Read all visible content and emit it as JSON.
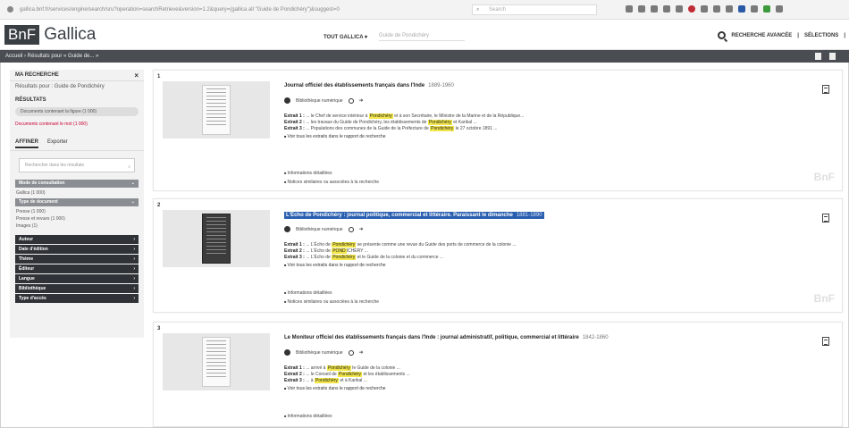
{
  "browser": {
    "url": "gallica.bnf.fr/services/engine/search/sru?operation=searchRetrieve&version=1.2&query=(gallica all \"Guide de Pondichéry\")&suggest=0",
    "search_placeholder": "Search"
  },
  "header": {
    "logo_bnf": "BnF",
    "logo_gallica": "Gallica",
    "nav_label": "TOUT GALLICA ▾",
    "search_value": "Guide de Pondichéry",
    "advanced_search": "RECHERCHE AVANCÉE",
    "selection": "SÉLECTIONS"
  },
  "breadcrumb": "Accueil › Résultats pour « Guide de... »",
  "sidebar": {
    "title": "MA RECHERCHE",
    "query": "Résultats pour : Guide de Pondichéry",
    "sort_heading": "RÉSULTATS",
    "pill": "Documents contenant la figure (1 000)",
    "link": "Documents contenant le mot (1 000)",
    "tab_refine": "AFFINER",
    "tab_other": "Exporter",
    "search_placeholder": "Rechercher dans les résultats",
    "facet_consult": "Mode de consultation",
    "consult_item": "Gallica (1 000)",
    "facet_doctype": "Type de document",
    "doctype_items": [
      "Presse (1 000)",
      "Presse et revues (1 000)",
      "Images (1)"
    ],
    "dark_facets": [
      "Auteur",
      "Date d'édition",
      "Thème",
      "Éditeur",
      "Langue",
      "Bibliothèque",
      "Type d'accès"
    ]
  },
  "results": [
    {
      "num": "1",
      "title": "Journal officiel des établissements français dans l'Inde",
      "date": "1889-1960",
      "meta": "Bibliothèque numérique",
      "extracts": [
        {
          "label": "Extrait 1 :",
          "pre": "... le Chef de service intérieur à ",
          "hl": "Pondichéry",
          "post": " et à son Secrétaire, le Ministre de la Marine et de la République..."
        },
        {
          "label": "Extrait 2 :",
          "pre": "... les travaux du Guide de Pondichéry, les établissements de ",
          "hl": "Pondichéry",
          "post": " et Karikal ..."
        },
        {
          "label": "Extrait 3 :",
          "pre": "... Populations des communes de la Guide de la Préfecture de ",
          "hl": "Pondichéry",
          "post": " le 27 octobre 1891 ..."
        }
      ],
      "more": "Voir tous les extraits dans le rapport de recherche",
      "links": [
        "Informations détaillées",
        "Notices similaires ou associées à la recherche"
      ]
    },
    {
      "num": "2",
      "title": "L'Écho de Pondichéry : journal politique, commercial et littéraire. Paraissant le dimanche",
      "date": "1881-1890",
      "meta": "Bibliothèque numérique",
      "extracts": [
        {
          "label": "Extrait 1 :",
          "pre": "... L'Écho de ",
          "hl": "Pondichéry",
          "post": " se présente comme une revue du Guide des ports de commerce de la colonie ..."
        },
        {
          "label": "Extrait 2 :",
          "pre": "... L'Écho de ",
          "hl": "POND",
          "post": "ICHÉRY ..."
        },
        {
          "label": "Extrait 3 :",
          "pre": "... L'Écho de ",
          "hl": "Pondichéry",
          "post": " et le Guide de la colonie et du commerce ..."
        }
      ],
      "more": "Voir tous les extraits dans le rapport de recherche",
      "links": [
        "Informations détaillées",
        "Notices similaires ou associées à la recherche"
      ]
    },
    {
      "num": "3",
      "title": "Le Moniteur officiel des établissements français dans l'Inde : journal administratif, politique, commercial et littéraire",
      "date": "1842-1860",
      "meta": "Bibliothèque numérique",
      "extracts": [
        {
          "label": "Extrait 1 :",
          "pre": "... arrivé à ",
          "hl": "Pondichéry",
          "post": " le Guide de la colonie ..."
        },
        {
          "label": "Extrait 2 :",
          "pre": "... le Conseil de ",
          "hl": "Pondichéry",
          "post": " et les établissements ..."
        },
        {
          "label": "Extrait 3 :",
          "pre": "... à ",
          "hl": "Pondichéry",
          "post": " et à Karikal ..."
        }
      ],
      "more": "Voir tous les extraits dans le rapport de recherche",
      "links": [
        "Informations détaillées"
      ]
    }
  ],
  "watermark": "BnF"
}
